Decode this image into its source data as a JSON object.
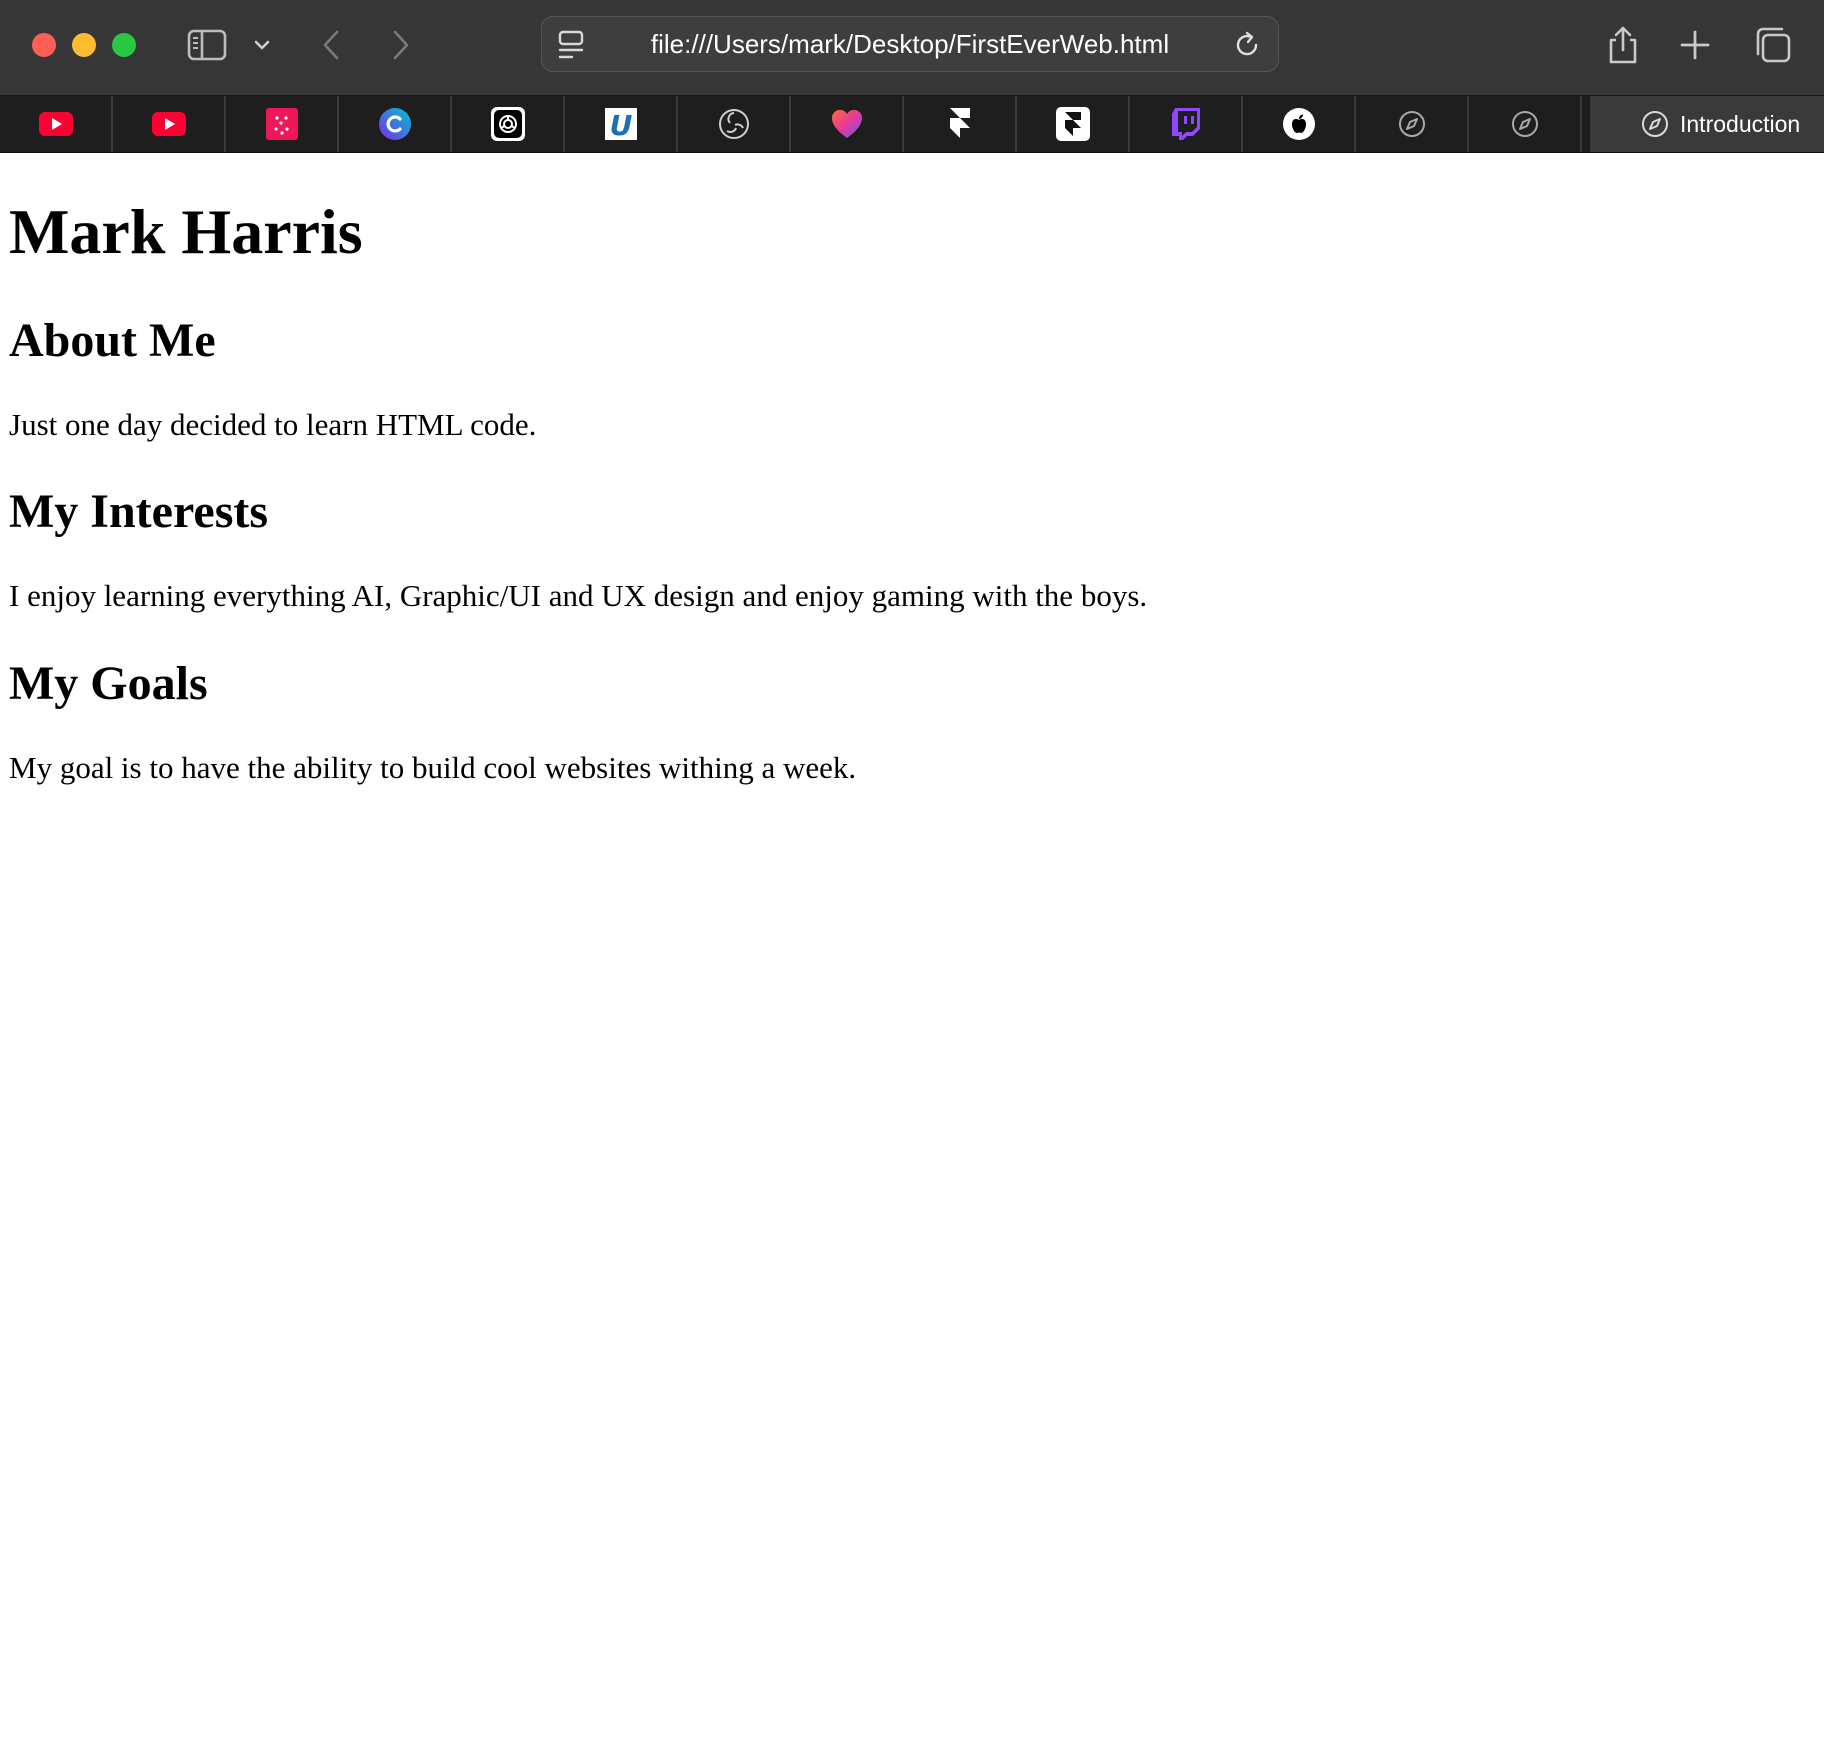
{
  "browser": {
    "url": "file:///Users/mark/Desktop/FirstEverWeb.html",
    "tabs": [
      {
        "icon": "youtube-icon"
      },
      {
        "icon": "youtube-icon"
      },
      {
        "icon": "pink-dots-app-icon"
      },
      {
        "icon": "canva-icon"
      },
      {
        "icon": "chatgpt-icon"
      },
      {
        "icon": "u-logo-icon"
      },
      {
        "icon": "obs-icon"
      },
      {
        "icon": "heart-app-icon"
      },
      {
        "icon": "framer-icon"
      },
      {
        "icon": "framer-icon"
      },
      {
        "icon": "twitch-icon"
      },
      {
        "icon": "apple-icon"
      },
      {
        "icon": "compass-icon"
      },
      {
        "icon": "compass-icon"
      }
    ],
    "active_tab": {
      "icon": "compass-icon",
      "title": "Introduction"
    }
  },
  "page": {
    "name": "Mark Harris",
    "sections": [
      {
        "heading": "About Me",
        "text": "Just one day decided to learn HTML code."
      },
      {
        "heading": "My Interests",
        "text": "I enjoy learning everything AI, Graphic/UI and UX design and enjoy gaming with the boys."
      },
      {
        "heading": "My Goals",
        "text": "My goal is to have the ability to build cool websites withing a week."
      }
    ]
  },
  "colors": {
    "toolbar": "#363637",
    "tabbar": "#1e1e1e",
    "close": "#ff5f57",
    "minimize": "#febc2e",
    "maximize": "#28c840"
  }
}
